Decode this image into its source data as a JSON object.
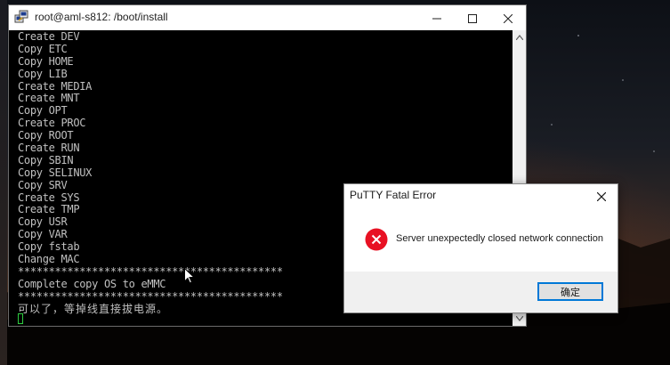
{
  "window": {
    "title": "root@aml-s812: /boot/install",
    "icons": {
      "app": "putty-icon",
      "minimize": "minimize-icon",
      "maximize": "maximize-icon",
      "close": "close-icon"
    }
  },
  "terminal": {
    "lines": [
      "Create DEV",
      "Copy ETC",
      "Copy HOME",
      "Copy LIB",
      "Create MEDIA",
      "Create MNT",
      "Copy OPT",
      "Create PROC",
      "Copy ROOT",
      "Create RUN",
      "Copy SBIN",
      "Copy SELINUX",
      "Copy SRV",
      "Create SYS",
      "Create TMP",
      "Copy USR",
      "Copy VAR",
      "Copy fstab",
      "Change MAC",
      "*******************************************",
      "Complete copy OS to eMMC",
      "*******************************************",
      "可以了，等掉线直接拔电源。"
    ],
    "text_color": "#c0c0c0",
    "cursor_color": "#2ecc40"
  },
  "dialog": {
    "title": "PuTTY Fatal Error",
    "message": "Server unexpectedly closed network connection",
    "ok_label": "确定",
    "icons": {
      "error": "error-icon",
      "close": "close-icon"
    },
    "accent": "#0078d7",
    "error_color": "#e81123"
  }
}
